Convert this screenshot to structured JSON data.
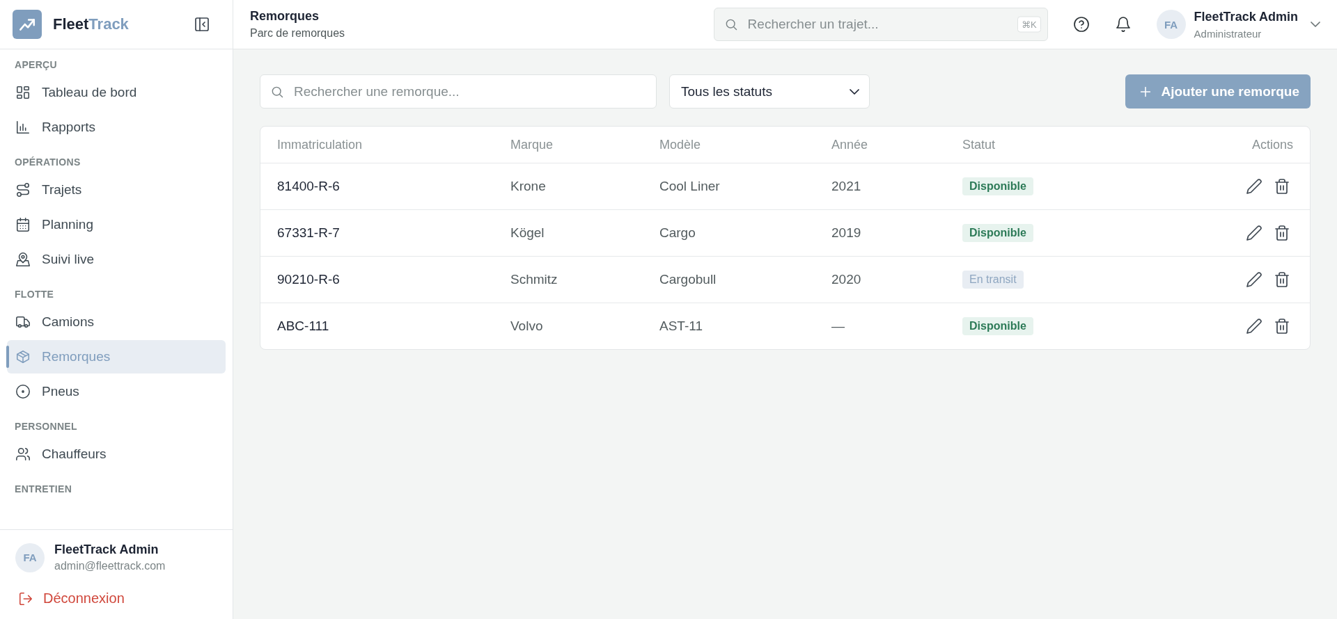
{
  "sidebar": {
    "brand": {
      "part_1": "Fleet",
      "part_2": "Track"
    },
    "sections": [
      {
        "label": "APERÇU",
        "items": [
          {
            "label": "Tableau de bord",
            "selected": false
          },
          {
            "label": "Rapports",
            "selected": false
          }
        ]
      },
      {
        "label": "OPÉRATIONS",
        "items": [
          {
            "label": "Trajets",
            "selected": false
          },
          {
            "label": "Planning",
            "selected": false
          },
          {
            "label": "Suivi live",
            "selected": false
          }
        ]
      },
      {
        "label": "FLOTTE",
        "items": [
          {
            "label": "Camions",
            "selected": false
          },
          {
            "label": "Remorques",
            "selected": true
          },
          {
            "label": "Pneus",
            "selected": false
          }
        ]
      },
      {
        "label": "PERSONNEL",
        "items": [
          {
            "label": "Chauffeurs",
            "selected": false
          }
        ]
      },
      {
        "label": "ENTRETIEN"
      }
    ],
    "user": {
      "initials": "FA",
      "name": "FleetTrack Admin",
      "email": "admin@fleettrack.com"
    },
    "logout": "Déconnexion"
  },
  "header": {
    "title": "Remorques",
    "subtitle": "Parc de remorques",
    "search": {
      "placeholder": "Rechercher un trajet...",
      "shortcut": "⌘K"
    },
    "user": {
      "initials": "FA",
      "name": "FleetTrack Admin",
      "role": "Administrateur"
    }
  },
  "toolbar": {
    "search": {
      "placeholder": "Rechercher une remorque..."
    },
    "status_filter": "Tous les statuts",
    "add_button": "Ajouter une remorque"
  },
  "table": {
    "columns": [
      "Immatriculation",
      "Marque",
      "Modèle",
      "Année",
      "Statut",
      "Actions"
    ],
    "rows": [
      {
        "plate": "81400-R-6",
        "brand": "Krone",
        "model": "Cool Liner",
        "year": "2021",
        "status": {
          "label": "Disponible",
          "kind": "available"
        }
      },
      {
        "plate": "67331-R-7",
        "brand": "Kögel",
        "model": "Cargo",
        "year": "2019",
        "status": {
          "label": "Disponible",
          "kind": "available"
        }
      },
      {
        "plate": "90210-R-6",
        "brand": "Schmitz",
        "model": "Cargobull",
        "year": "2020",
        "status": {
          "label": "En transit",
          "kind": "transit"
        }
      },
      {
        "plate": "ABC-111",
        "brand": "Volvo",
        "model": "AST-11",
        "year": "—",
        "status": {
          "label": "Disponible",
          "kind": "available"
        }
      }
    ]
  }
}
